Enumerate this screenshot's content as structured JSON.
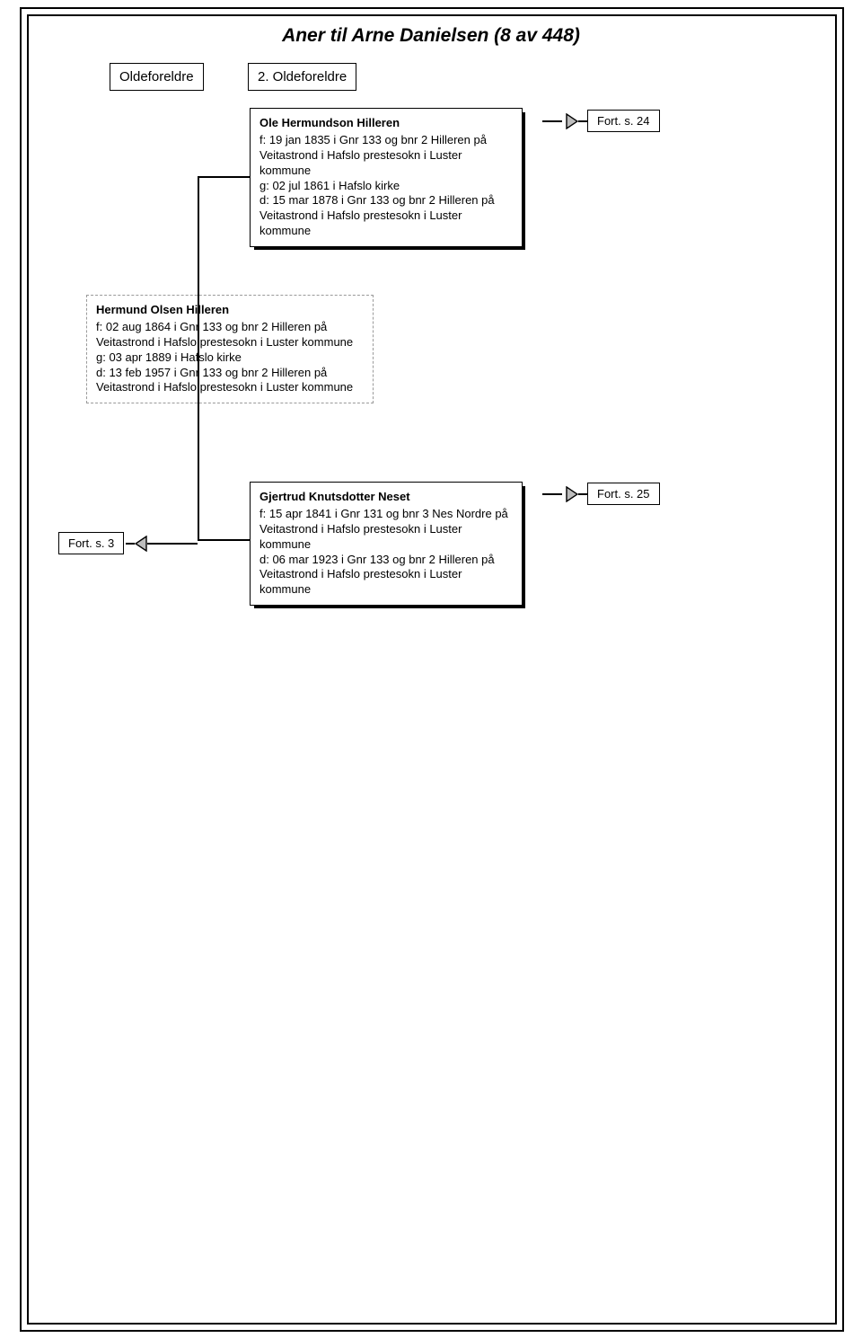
{
  "title": "Aner til Arne Danielsen (8 av 448)",
  "headers": {
    "col1": "Oldeforeldre",
    "col2": "2. Oldeforeldre"
  },
  "person_father": {
    "name": "Ole Hermundson Hilleren",
    "f": "f: 19 jan 1835 i Gnr 133 og bnr 2 Hilleren på Veitastrond i Hafslo prestesokn i Luster kommune",
    "g": "g: 02 jul 1861 i Hafslo kirke",
    "d": "d: 15 mar 1878 i Gnr 133 og bnr 2 Hilleren på Veitastrond i Hafslo prestesokn i Luster kommune"
  },
  "person_center": {
    "name": "Hermund Olsen Hilleren",
    "f": "f: 02 aug 1864 i Gnr 133 og bnr 2 Hilleren på Veitastrond i Hafslo prestesokn i Luster kommune",
    "g": "g: 03 apr 1889 i Hafslo kirke",
    "d": "d: 13 feb 1957 i Gnr 133 og bnr 2 Hilleren på Veitastrond i Hafslo prestesokn i Luster kommune"
  },
  "person_mother": {
    "name": "Gjertrud Knutsdotter Neset",
    "f": "f: 15 apr 1841 i Gnr 131 og bnr 3 Nes Nordre på Veitastrond i Hafslo prestesokn i Luster kommune",
    "d": "d: 06 mar 1923 i Gnr 133 og bnr 2 Hilleren på Veitastrond i Hafslo prestesokn i Luster kommune"
  },
  "links": {
    "father": "Fort. s. 24",
    "mother": "Fort. s. 25",
    "center": "Fort. s. 3"
  }
}
